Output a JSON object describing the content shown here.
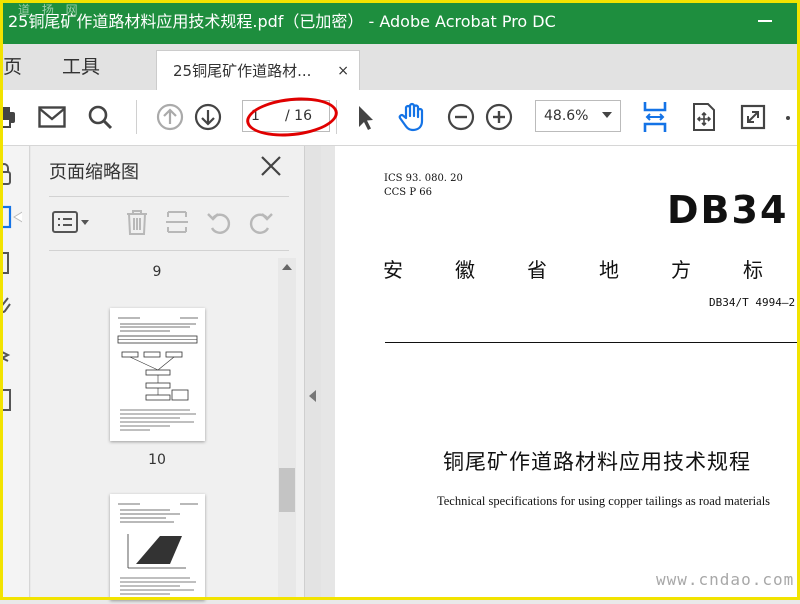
{
  "window": {
    "title": "25铜尾矿作道路材料应用技术规程.pdf（已加密） - Adobe Acrobat Pro DC",
    "watermark_top": "道 扬 网"
  },
  "nav": {
    "home": "主页",
    "tools": "工具",
    "doc_tab": "25铜尾矿作道路材...",
    "close_tab": "×"
  },
  "toolbar": {
    "current_page": "1",
    "total_pages": "/ 16",
    "zoom": "48.6%"
  },
  "thumbnails_panel": {
    "title": "页面缩略图",
    "pages": [
      "9",
      "10"
    ]
  },
  "document": {
    "ics": "ICS  93. 080. 20",
    "ccs": "CCS  P  66",
    "db_code": "DB34",
    "province": "安徽省地方标",
    "standard_no": "DB34/T 4994—2",
    "title_cn": "铜尾矿作道路材料应用技术规程",
    "title_en": "Technical specifications for using copper tailings as road materials"
  },
  "site_watermark": "www.cndao.com",
  "colors": {
    "titlebar": "#1e8e3e",
    "frame": "#f2e300",
    "accent_blue": "#1473e6",
    "highlight_red": "#e00000"
  }
}
